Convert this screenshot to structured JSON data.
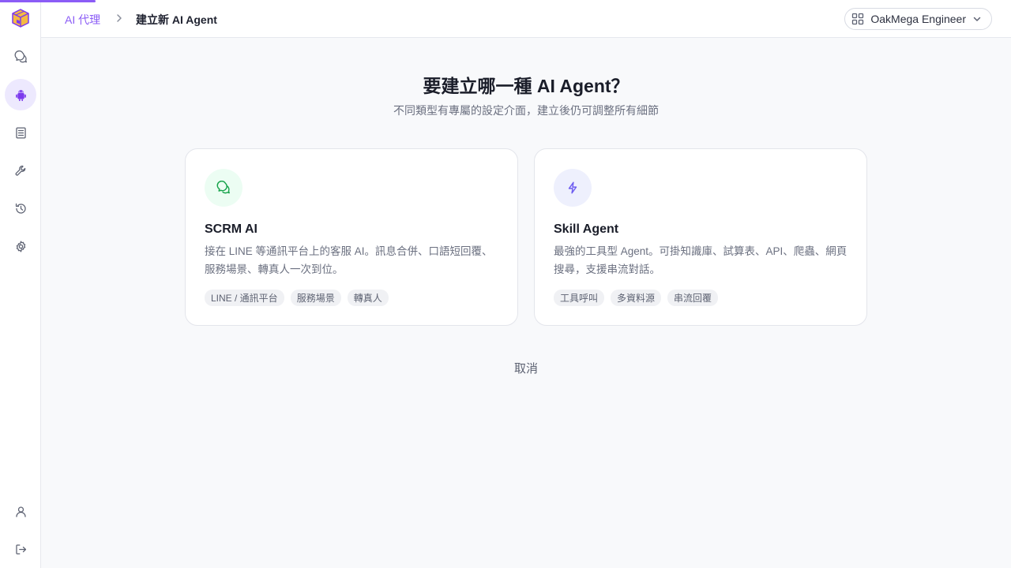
{
  "breadcrumb": {
    "parent": "AI 代理",
    "current": "建立新 AI Agent"
  },
  "workspace": {
    "name": "OakMega Engineer"
  },
  "page": {
    "title": "要建立哪一種 AI Agent？",
    "subtitle": "不同類型有專屬的設定介面，建立後仍可調整所有細節",
    "cancel_label": "取消"
  },
  "cards": [
    {
      "title": "SCRM AI",
      "description": "接在 LINE 等通訊平台上的客服 AI。訊息合併、口語短回覆、服務場景、轉真人一次到位。",
      "tags": [
        "LINE / 通訊平台",
        "服務場景",
        "轉真人"
      ],
      "icon": "chat-icon",
      "icon_color": "#16a34a",
      "icon_bg": "#ecfdf3"
    },
    {
      "title": "Skill Agent",
      "description": "最強的工具型 Agent。可掛知識庫、試算表、API、爬蟲、網頁搜尋，支援串流對話。",
      "tags": [
        "工具呼叫",
        "多資料源",
        "串流回覆"
      ],
      "icon": "lightning-icon",
      "icon_color": "#6d5cf0",
      "icon_bg": "#eef0fd"
    }
  ],
  "sidebar": {
    "items": [
      "chat-icon",
      "robot-icon",
      "document-icon",
      "wrench-icon",
      "history-icon",
      "gear-icon"
    ],
    "bottom": [
      "user-icon",
      "logout-icon"
    ],
    "active": "robot-icon"
  },
  "colors": {
    "accent": "#8b5cf6",
    "active_bg": "#ede9fe"
  }
}
